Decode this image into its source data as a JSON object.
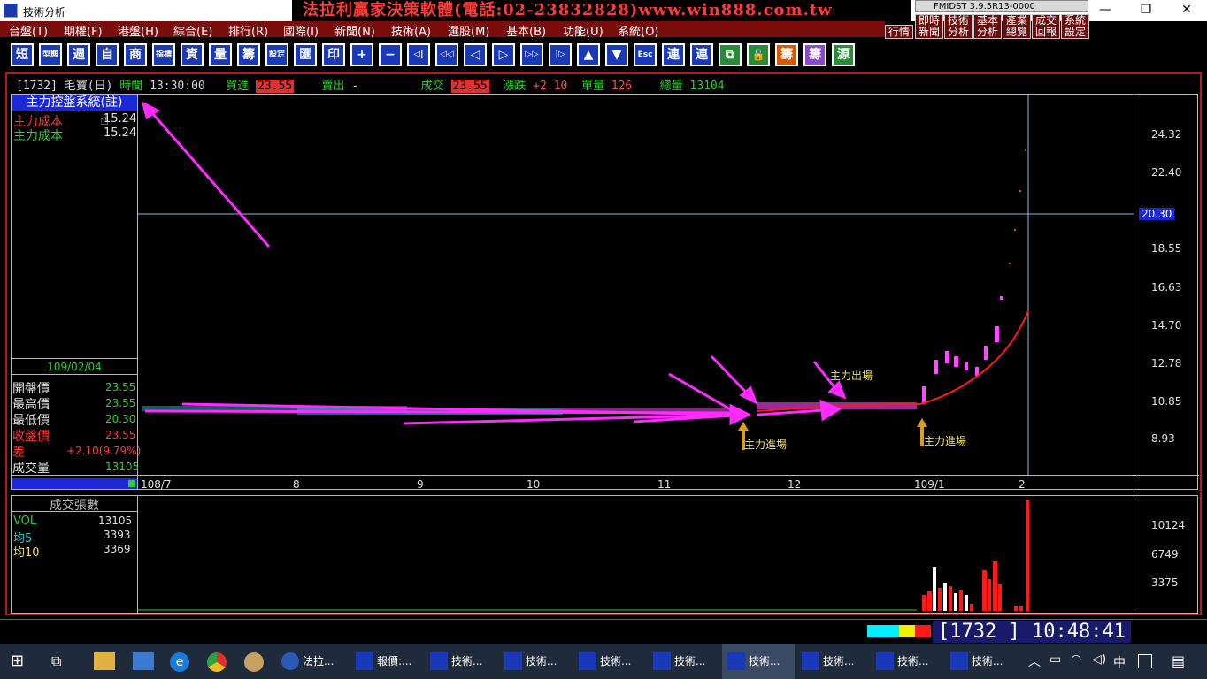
{
  "window": {
    "title": "技術分析",
    "banner": "法拉利贏家決策軟體(電話:02-23832828)www.win888.com.tw",
    "version": "FMIDST 3.9.5R13-0000",
    "minimize": "—",
    "restore": "❐",
    "close": "✕"
  },
  "menu": [
    "台盤(T)",
    "期權(F)",
    "港盤(H)",
    "綜合(E)",
    "排行(R)",
    "國際(I)",
    "新聞(N)",
    "技術(A)",
    "選股(M)",
    "基本(B)",
    "功能(U)",
    "系統(O)"
  ],
  "quick_buttons": [
    "行情",
    "即時\n新聞",
    "技術\n分析",
    "基本\n分析",
    "產業\n總覽",
    "成交\n回報",
    "系統\n設定"
  ],
  "toolbar": [
    "短",
    "型態",
    "週",
    "自",
    "商",
    "指標",
    "資",
    "量",
    "籌",
    "設定",
    "匯",
    "印",
    "+",
    "−",
    "◁|",
    "◁◁",
    "◁",
    "▷",
    "▷▷",
    "|▷",
    "▲",
    "▼",
    "Esc",
    "連",
    "連",
    "⧉",
    "🔓",
    "籌",
    "籌",
    "源"
  ],
  "quote": {
    "code": "[1732]",
    "name": "毛寶(日)",
    "time_label": "時間",
    "time": "13:30:00",
    "bid_label": "買進",
    "bid": "23.55",
    "ask_label": "賣出",
    "ask": "-",
    "deal_label": "成交",
    "deal": "23.55",
    "change_label": "漲跌",
    "change": "+2.10",
    "lot_label": "單量",
    "lot": "126",
    "total_label": "總量",
    "total": "13104"
  },
  "indicator_panel": {
    "title": "主力控盤系統(註)",
    "rows": [
      {
        "label": "主力成本",
        "value": "15.24"
      },
      {
        "label": "主力成本",
        "value": "15.24"
      }
    ]
  },
  "ohlc_panel": {
    "date": "109/02/04",
    "rows": [
      {
        "label": "開盤價",
        "value": "23.55"
      },
      {
        "label": "最高價",
        "value": "23.55"
      },
      {
        "label": "最低價",
        "value": "20.30"
      },
      {
        "label": "收盤價",
        "value": "23.55"
      },
      {
        "label": "差",
        "value": "+2.10(9.79%)"
      },
      {
        "label": "成交量",
        "value": "13105"
      }
    ]
  },
  "price_axis": [
    "24.32",
    "22.40",
    "20.30",
    "18.55",
    "16.63",
    "14.70",
    "12.78",
    "10.85",
    "8.93"
  ],
  "x_axis": [
    "108/7",
    "8",
    "9",
    "10",
    "11",
    "12",
    "109/1",
    "2"
  ],
  "annotations": [
    "主力進場",
    "主力出場",
    "主力進場"
  ],
  "volume_panel": {
    "title": "成交張數",
    "rows": [
      {
        "label": "VOL",
        "value": "13105"
      },
      {
        "label": "均5",
        "value": "3393"
      },
      {
        "label": "均10",
        "value": "3369"
      }
    ],
    "axis": [
      "10124",
      "6749",
      "3375"
    ]
  },
  "status": {
    "code": "[1732  ]",
    "clock": "10:48:41"
  },
  "taskbar": {
    "tasks": [
      "法拉...",
      "報價:...",
      "技術...",
      "技術...",
      "技術...",
      "技術...",
      "技術...",
      "技術...",
      "技術...",
      "技術..."
    ],
    "ime": "中"
  },
  "colors": {
    "accent_red": "#e03030",
    "menu_bg": "#7a0c0c",
    "magenta": "#ff2aff",
    "up": "#ff4aff",
    "down": "#2ab8c8"
  }
}
